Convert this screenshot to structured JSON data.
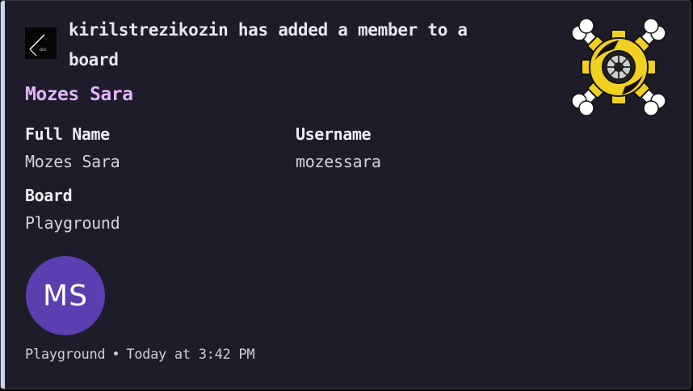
{
  "author": {
    "name": "kirilstrezikozin",
    "action": "has added a member to a board"
  },
  "title": "Mozes Sara",
  "fields": [
    {
      "name": "Full Name",
      "value": "Mozes Sara"
    },
    {
      "name": "Username",
      "value": "mozessara"
    },
    {
      "name": "Board",
      "value": "Playground"
    }
  ],
  "member_avatar": {
    "initials": "MS",
    "color": "#5b3fb0"
  },
  "footer": {
    "text": "Playground",
    "separator": "•",
    "timestamp": "Today at 3:42 PM"
  },
  "colors": {
    "accent_bar": "#c9d6ee",
    "title": "#e3b5ff",
    "background": "#1d1c28"
  },
  "thumbnail": {
    "icon": "gear-skull-crossbones-icon"
  }
}
